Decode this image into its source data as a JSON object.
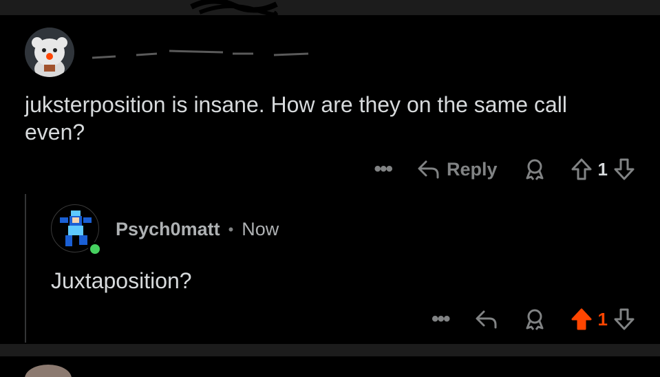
{
  "parent_comment": {
    "username": "",
    "timestamp": "",
    "text": "juksterposition is insane. How are they on the same call even?",
    "actions": {
      "more_label": "•••",
      "reply_label": "Reply",
      "vote_count": "1"
    }
  },
  "reply_comment": {
    "username": "Psych0matt",
    "separator": "•",
    "timestamp": "Now",
    "text": "Juxtaposition?",
    "upvoted": true,
    "actions": {
      "more_label": "•••",
      "vote_count": "1"
    }
  },
  "colors": {
    "upvote_active": "#ff4500",
    "online": "#46d160",
    "muted": "#818384"
  },
  "icons": [
    "reply-icon",
    "award-icon",
    "upvote-icon",
    "downvote-icon",
    "more-icon"
  ]
}
